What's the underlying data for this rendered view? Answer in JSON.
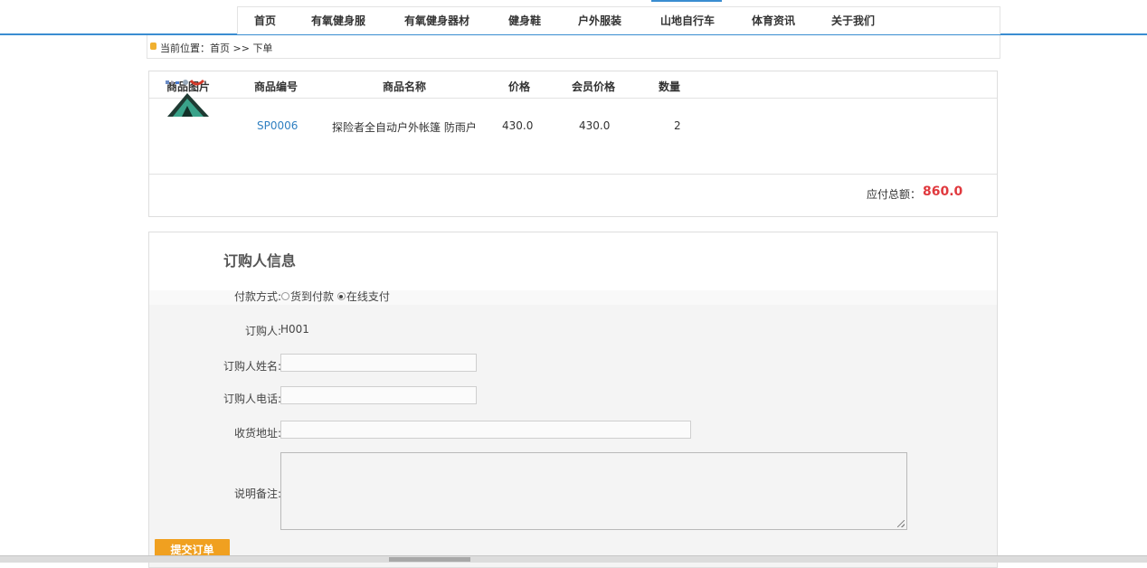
{
  "nav": {
    "items": [
      "首页",
      "有氧健身服",
      "有氧健身器材",
      "健身鞋",
      "户外服装",
      "山地自行车",
      "体育资讯",
      "关于我们"
    ]
  },
  "breadcrumb": {
    "prefix": "当前位置：",
    "home": "首页",
    "sep": " >> ",
    "current": "下单"
  },
  "cart": {
    "headers": [
      "商品图片",
      "商品编号",
      "商品名称",
      "价格",
      "会员价格",
      "数量"
    ],
    "rows": [
      {
        "code": "SP0006",
        "name": "探险者全自动户外帐篷 防雨户",
        "price": "430.0",
        "member_price": "430.0",
        "qty": "2"
      }
    ],
    "total_label": "应付总额：",
    "total_value": "860.0"
  },
  "order": {
    "title": "订购人信息",
    "payment_label": "付款方式:",
    "payment_options": [
      "货到付款",
      "在线支付"
    ],
    "payment_selected": "在线支付",
    "buyer_label": "订购人:",
    "buyer_value": "H001",
    "name_label": "订购人姓名:",
    "phone_label": "订购人电话:",
    "address_label": "收货地址:",
    "note_label": "说明备注:",
    "submit_label": "提交订单"
  },
  "colors": {
    "accent": "#3a8dd1",
    "total": "#e0393e",
    "submit": "#f0a020",
    "link": "#2f7fc1"
  }
}
